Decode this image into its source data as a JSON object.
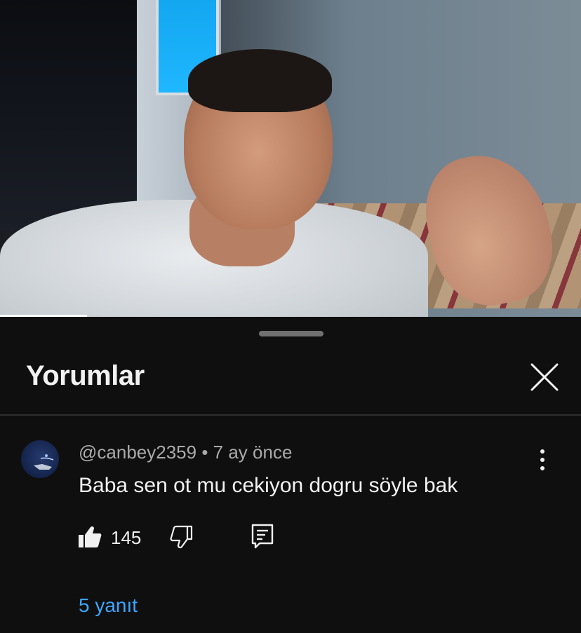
{
  "comments_panel": {
    "title": "Yorumlar"
  },
  "comment": {
    "author": "@canbey2359",
    "separator": "•",
    "time": "7 ay önce",
    "text": "Baba sen ot mu cekiyon dogru söyle bak",
    "like_count": "145",
    "replies_label": "5 yanıt"
  },
  "icons": {
    "close": "close-icon",
    "more": "more-vertical-icon",
    "like": "thumbs-up-icon",
    "dislike": "thumbs-down-icon",
    "reply": "reply-icon"
  },
  "colors": {
    "background": "#0f0f0f",
    "text_primary": "#f1f1f1",
    "text_secondary": "#aaaaaa",
    "link": "#3ea6ff"
  },
  "video": {
    "progress": 0.15
  }
}
